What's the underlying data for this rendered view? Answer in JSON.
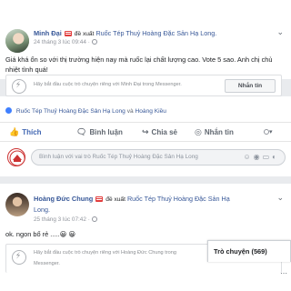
{
  "post1": {
    "author": "Minh Đại",
    "recommend_text": "đề xuất",
    "page_name": "Ruốc Tép Thuỷ Hoàng Đặc Sản Hạ Long",
    "page_suffix": ".",
    "time": "24 tháng 3 lúc 09:44 ·",
    "body": "Giá khá ổn so với thị trường hiện nay mà ruốc lại chất lượng cao. Vote 5 sao. Anh chị chủ nhiệt tình quá!",
    "messenger_prompt": "Hãy bắt đầu cuộc trò chuyện riêng với Minh Đại trong Messenger.",
    "message_button": "Nhắn tin"
  },
  "share_line": {
    "page_link": "Ruốc Tép Thuỷ Hoàng Đặc Sản Hạ Long",
    "connector": "và",
    "other_link": "Hoàng Kiều"
  },
  "actions": {
    "like": "Thích",
    "comment": "Bình luận",
    "share": "Chia sẻ",
    "message": "Nhắn tin"
  },
  "comment_box": {
    "placeholder": "Bình luận với vai trò Ruốc Tép Thuỷ Hoàng Đặc Sản Hạ Long",
    "icons": [
      "emoji-icon",
      "camera-icon",
      "gif-icon",
      "sticker-icon"
    ]
  },
  "post2": {
    "author": "Hoàng Đức Chung",
    "recommend_text": "đề xuất",
    "page_name_line1": "Ruốc Tép Thuỷ Hoàng Đặc Sản Hạ",
    "page_name_line2": "Long.",
    "time": "25 tháng 3 lúc 07:42 ·",
    "body": "ok. ngon bổ rẻ .....😀 😀",
    "messenger_prompt_line1": "Hãy bắt đầu cuộc trò chuyện riêng với Hoàng Đức Chung trong",
    "messenger_prompt_line2": "Messenger."
  },
  "chat": {
    "label": "Trò chuyện (569)"
  },
  "colors": {
    "link_blue": "#385898",
    "like_blue": "#4267b2",
    "background": "#e9ebee"
  }
}
